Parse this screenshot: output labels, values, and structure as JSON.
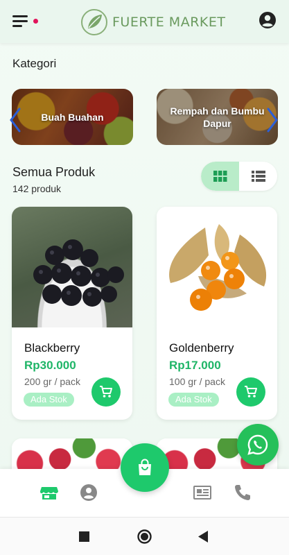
{
  "header": {
    "brand": "FUERTE MARKET",
    "menu_icon": "hamburger-menu-icon",
    "notification_color": "#e1145b",
    "account_icon": "account-circle-icon"
  },
  "categories": {
    "title": "Kategori",
    "items": [
      {
        "label": "Buah Buahan"
      },
      {
        "label": "Rempah dan Bumbu Dapur"
      }
    ]
  },
  "products": {
    "title": "Semua Produk",
    "count": "142 produk",
    "view_modes": [
      "grid",
      "list"
    ],
    "active_view": "grid",
    "items": [
      {
        "name": "Blackberry",
        "price": "Rp30.000",
        "unit": "200 gr / pack",
        "stock": "Ada Stok"
      },
      {
        "name": "Goldenberry",
        "price": "Rp17.000",
        "unit": "100 gr / pack",
        "stock": "Ada Stok"
      }
    ]
  },
  "bottom_nav": {
    "items": [
      "store-icon",
      "profile-icon",
      "shopping-bag-icon",
      "news-icon",
      "phone-icon"
    ],
    "active": "store-icon"
  },
  "colors": {
    "accent": "#1ec96c",
    "price": "#1fb567",
    "header_bg": "#eaf6ee",
    "whatsapp": "#25c05a"
  }
}
